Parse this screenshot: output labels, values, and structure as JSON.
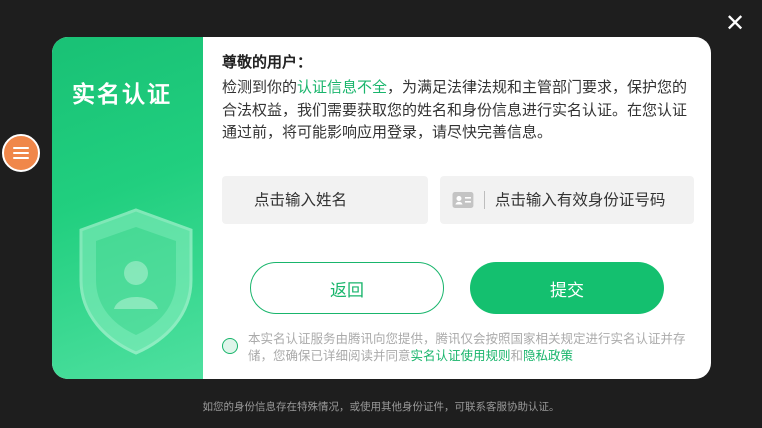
{
  "close": {
    "symbol": "✕"
  },
  "banner": {
    "title": "实名认证"
  },
  "dialog": {
    "greeting": "尊敬的用户：",
    "message_pre": "检测到你的",
    "message_highlight": "认证信息不全",
    "message_post": "，为满足法律法规和主管部门要求，保护您的合法权益，我们需要获取您的姓名和身份信息进行实名认证。在您认证通过前，将可能影响应用登录，请尽快完善信息。"
  },
  "form": {
    "name_placeholder": "点击输入姓名",
    "id_placeholder": "点击输入有效身份证号码"
  },
  "buttons": {
    "back": "返回",
    "submit": "提交"
  },
  "agreement": {
    "text": "本实名认证服务由腾讯向您提供，腾讯仅会按照国家相关规定进行实名认证并存储，您确保已详细阅读并同意",
    "link1": "实名认证使用规则",
    "conj": "和",
    "link2": "隐私政策"
  },
  "footer": {
    "text": "如您的身份信息存在特殊情况，或使用其他身份证件，可联系客服协助认证。"
  },
  "colors": {
    "accent": "#19b56c",
    "banner": "#1ec878",
    "menu_button": "#f0874a"
  },
  "icons": [
    "close-icon",
    "menu-icon",
    "shield-icon",
    "user-icon",
    "id-card-icon"
  ]
}
